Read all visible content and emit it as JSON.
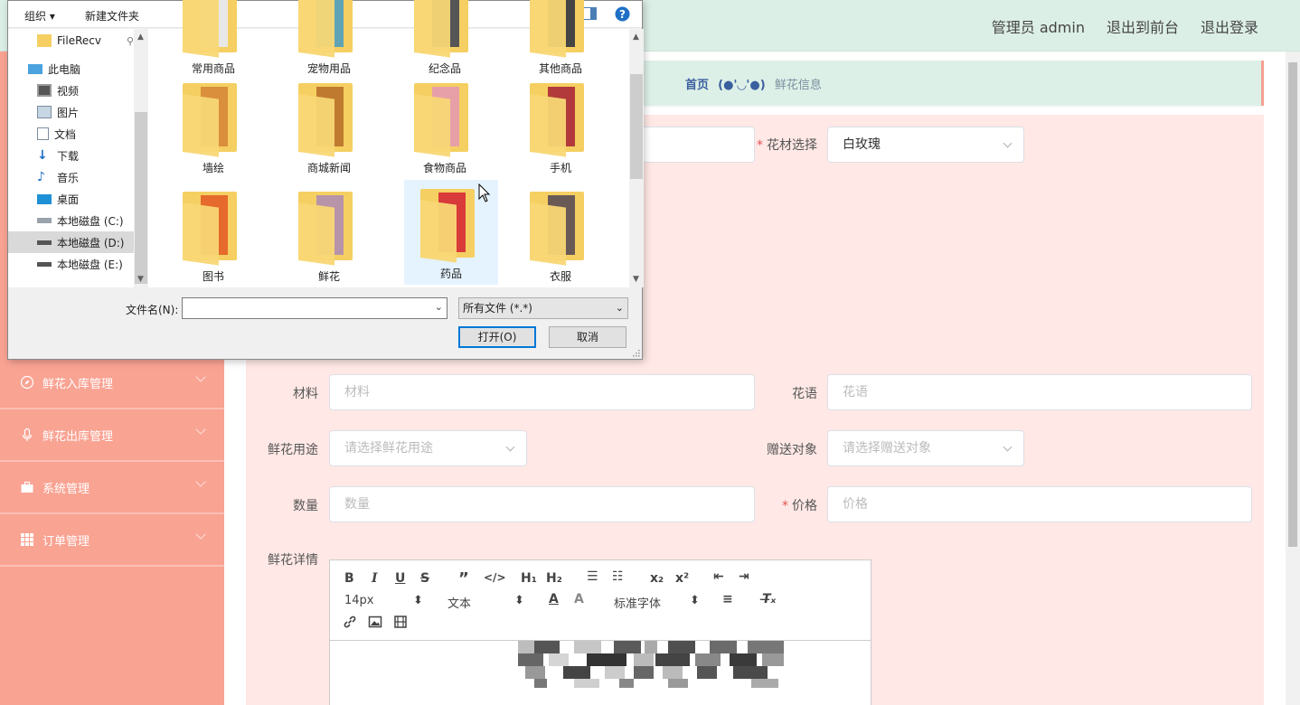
{
  "header": {
    "admin_label": "管理员 admin",
    "to_front_label": "退出到前台",
    "logout_label": "退出登录"
  },
  "breadcrumb": {
    "home": "首页",
    "separator": "(●'◡'●)",
    "current": "鲜花信息"
  },
  "sidebar": {
    "items": [
      {
        "label": "鲜花入库管理",
        "icon": "compass-icon"
      },
      {
        "label": "鲜花出库管理",
        "icon": "microphone-icon"
      },
      {
        "label": "系统管理",
        "icon": "briefcase-icon"
      },
      {
        "label": "订单管理",
        "icon": "grid-icon"
      }
    ]
  },
  "form": {
    "material_select": {
      "label": "花材选择",
      "value": "白玫瑰"
    },
    "material": {
      "label": "材料",
      "placeholder": "材料"
    },
    "flower_language": {
      "label": "花语",
      "placeholder": "花语"
    },
    "usage": {
      "label": "鲜花用途",
      "placeholder": "请选择鲜花用途"
    },
    "recipient": {
      "label": "赠送对象",
      "placeholder": "请选择赠送对象"
    },
    "quantity": {
      "label": "数量",
      "placeholder": "数量"
    },
    "price": {
      "label": "价格",
      "placeholder": "价格"
    },
    "details": {
      "label": "鲜花详情"
    }
  },
  "editor": {
    "font_size": "14px",
    "block_type": "文本",
    "font_family": "标准字体"
  },
  "file_dialog": {
    "toolbar": {
      "organize": "组织",
      "new_folder": "新建文件夹"
    },
    "nav": [
      {
        "label": "FileRecv",
        "icon": "folder-icon"
      },
      {
        "label": "此电脑",
        "icon": "computer-icon"
      },
      {
        "label": "视频",
        "icon": "video-icon"
      },
      {
        "label": "图片",
        "icon": "picture-icon"
      },
      {
        "label": "文档",
        "icon": "document-icon"
      },
      {
        "label": "下载",
        "icon": "download-icon"
      },
      {
        "label": "音乐",
        "icon": "music-icon"
      },
      {
        "label": "桌面",
        "icon": "desktop-icon"
      },
      {
        "label": "本地磁盘 (C:)",
        "icon": "drive-icon"
      },
      {
        "label": "本地磁盘 (D:)",
        "icon": "drive-icon"
      },
      {
        "label": "本地磁盘 (E:)",
        "icon": "drive-icon"
      }
    ],
    "folders": [
      {
        "name": "常用商品"
      },
      {
        "name": "宠物用品"
      },
      {
        "name": "纪念品"
      },
      {
        "name": "其他商品"
      },
      {
        "name": "墙绘"
      },
      {
        "name": "商城新闻"
      },
      {
        "name": "食物商品"
      },
      {
        "name": "手机"
      },
      {
        "name": "图书"
      },
      {
        "name": "鲜花"
      },
      {
        "name": "药品"
      },
      {
        "name": "衣服"
      }
    ],
    "filename_label": "文件名(N):",
    "filename_value": "",
    "file_type": "所有文件 (*.*)",
    "open_label": "打开(O)",
    "cancel_label": "取消"
  },
  "colors": {
    "sidebar": "#f9a393",
    "header": "#dcefe6",
    "form_panel": "#ffe8e5",
    "accent": "#0078d7"
  }
}
